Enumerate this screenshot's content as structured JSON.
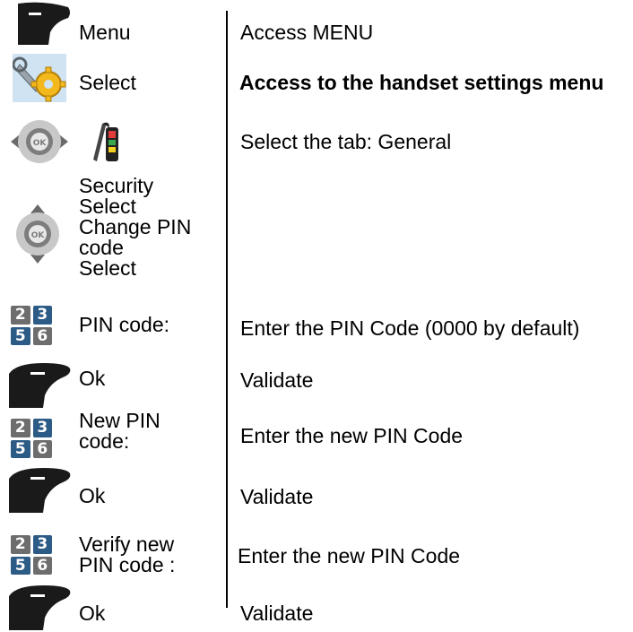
{
  "rows": [
    {
      "icon": "softkey-icon",
      "label": "Menu",
      "description": "Access MENU"
    },
    {
      "icon": "settings-tools-icon",
      "label": "Select",
      "description": "Access to the handset settings menu"
    },
    {
      "icon": "navigator-left-right-icon",
      "icon2": "phone-tools-tab-icon",
      "label": "",
      "description": "Select the tab: General"
    },
    {
      "icon": "navigator-up-down-icon",
      "label": "Security\nSelect\nChange PIN code\nSelect",
      "description": ""
    },
    {
      "icon": "keypad-icon",
      "label": "PIN code:",
      "description": "Enter the PIN Code (0000 by default)"
    },
    {
      "icon": "softkey-icon",
      "label": "Ok",
      "description": "Validate"
    },
    {
      "icon": "keypad-icon",
      "label": "New PIN code:",
      "description": "Enter the new PIN Code"
    },
    {
      "icon": "softkey-icon",
      "label": "Ok",
      "description": "Validate"
    },
    {
      "icon": "keypad-icon",
      "label": "Verify new PIN code :",
      "description": "Enter the new PIN Code"
    },
    {
      "icon": "softkey-icon",
      "label": "Ok",
      "description": "Validate"
    }
  ],
  "keypad_digits": [
    "2",
    "3",
    "5",
    "6"
  ],
  "colors": {
    "softkey": "#1a1a1a",
    "keypad_blue": "#2c5b86",
    "keypad_grey": "#6d6d6d",
    "navigator": "#b9b9b9",
    "divider": "#000000"
  }
}
